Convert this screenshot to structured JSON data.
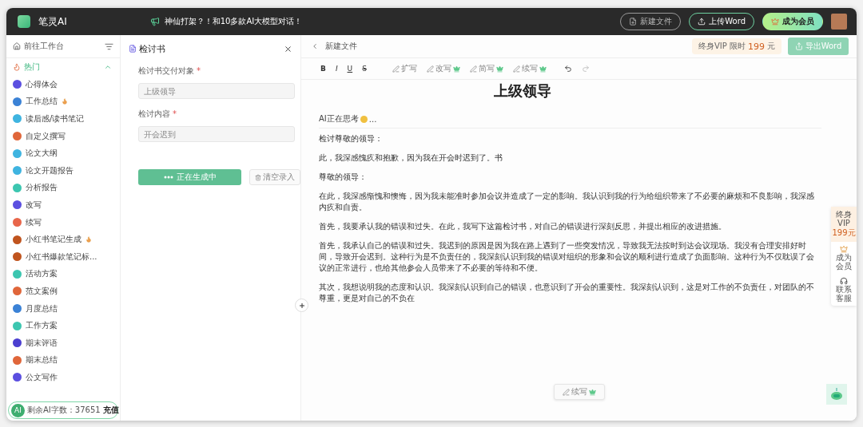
{
  "app": {
    "name": "笔灵AI",
    "announcement": "神仙打架？！和10多款AI大模型对话！",
    "buttons": [
      {
        "label": "新建文件",
        "kind": "outline"
      },
      {
        "label": "上传Word",
        "kind": "green-outline"
      },
      {
        "label": "成为会员",
        "kind": "vip"
      }
    ]
  },
  "sidebar": {
    "home": "前往工作台",
    "section": {
      "label": "热门",
      "expanded": true
    },
    "items": [
      {
        "label": "心得体会",
        "color": "#5b4fe0",
        "hot": false
      },
      {
        "label": "工作总结",
        "color": "#3b82d6",
        "hot": true
      },
      {
        "label": "读后感/读书笔记",
        "color": "#3fb4e0",
        "hot": false
      },
      {
        "label": "自定义撰写",
        "color": "#e0663a",
        "hot": false
      },
      {
        "label": "论文大纲",
        "color": "#3fb4e0",
        "hot": false
      },
      {
        "label": "论文开题报告",
        "color": "#3fb4e0",
        "hot": false
      },
      {
        "label": "分析报告",
        "color": "#3cc6b0",
        "hot": false
      },
      {
        "label": "改写",
        "color": "#5b4fe0",
        "hot": false
      },
      {
        "label": "续写",
        "color": "#e8664a",
        "hot": false
      },
      {
        "label": "小红书笔记生成",
        "color": "#c0541e",
        "hot": true
      },
      {
        "label": "小红书爆款笔记标...",
        "color": "#c0541e",
        "hot": false
      },
      {
        "label": "活动方案",
        "color": "#3cc6b0",
        "hot": false
      },
      {
        "label": "范文案例",
        "color": "#e0663a",
        "hot": false
      },
      {
        "label": "月度总结",
        "color": "#3b82d6",
        "hot": false
      },
      {
        "label": "工作方案",
        "color": "#3cc6b0",
        "hot": false
      },
      {
        "label": "期末评语",
        "color": "#4b3fd0",
        "hot": false
      },
      {
        "label": "期末总结",
        "color": "#e0663a",
        "hot": false
      },
      {
        "label": "公文写作",
        "color": "#5b4fe0",
        "hot": false
      }
    ],
    "quota": {
      "avatar": "AI",
      "label": "剩余AI字数：37651",
      "action": "充值"
    }
  },
  "form": {
    "title": "检讨书",
    "fields": [
      {
        "label": "检讨书交付对象",
        "required_mark": "*",
        "placeholder": "上级领导"
      },
      {
        "label": "检讨内容",
        "required_mark": "*",
        "placeholder": "开会迟到"
      }
    ],
    "generate": {
      "label": "正在生成中",
      "loading": true
    },
    "clear": {
      "label": "清空录入",
      "disabled": true
    }
  },
  "editor": {
    "file": "新建文件",
    "promo": {
      "label": "终身VIP 限时",
      "price": "199",
      "unit": "元"
    },
    "export": {
      "label": "导出Word",
      "disabled": true
    },
    "tools": [
      {
        "kind": "bold",
        "label": "B"
      },
      {
        "kind": "italic",
        "label": "I"
      },
      {
        "kind": "underline",
        "label": "U"
      },
      {
        "kind": "strike",
        "label": "S"
      }
    ],
    "ai_tools": [
      {
        "label": "扩写",
        "vip": false
      },
      {
        "label": "改写",
        "vip": true
      },
      {
        "label": "简写",
        "vip": true
      },
      {
        "label": "续写",
        "vip": true
      }
    ],
    "heading": "上级领导",
    "status": "AI正在思考",
    "status_suffix": "...",
    "paragraphs": [
      "检讨尊敬的领导：",
      "此，我深感愧疚和抱歉，因为我在开会时迟到了。书",
      "尊敬的领导：",
      "在此，我深感惭愧和懊悔，因为我未能准时参加会议并造成了一定的影响。我认识到我的行为给组织带来了不必要的麻烦和不良影响，我深感内疚和自责。",
      "首先，我要承认我的错误和过失。在此，我写下这篇检讨书，对自己的错误进行深刻反思，并提出相应的改进措施。",
      "首先，我承认自己的错误和过失。我迟到的原因是因为我在路上遇到了一些突发情况，导致我无法按时到达会议现场。我没有合理安排好时间，导致开会迟到。这种行为是不负责任的，我深刻认识到我的错误对组织的形象和会议的顺利进行造成了负面影响。这种行为不仅耽误了会议的正常进行，也给其他参会人员带来了不必要的等待和不便。",
      "其次，我想说明我的态度和认识。我深刻认识到自己的错误，也意识到了开会的重要性。我深刻认识到，这是对工作的不负责任，对团队的不尊重，更是对自己的不负在"
    ],
    "float_button": {
      "label": "续写",
      "vip": true
    }
  },
  "side_float": [
    {
      "kind": "promo",
      "label": "终身VIP",
      "price": "199元"
    },
    {
      "kind": "vip",
      "label": "成为会员"
    },
    {
      "kind": "service",
      "label": "联系客服"
    }
  ]
}
